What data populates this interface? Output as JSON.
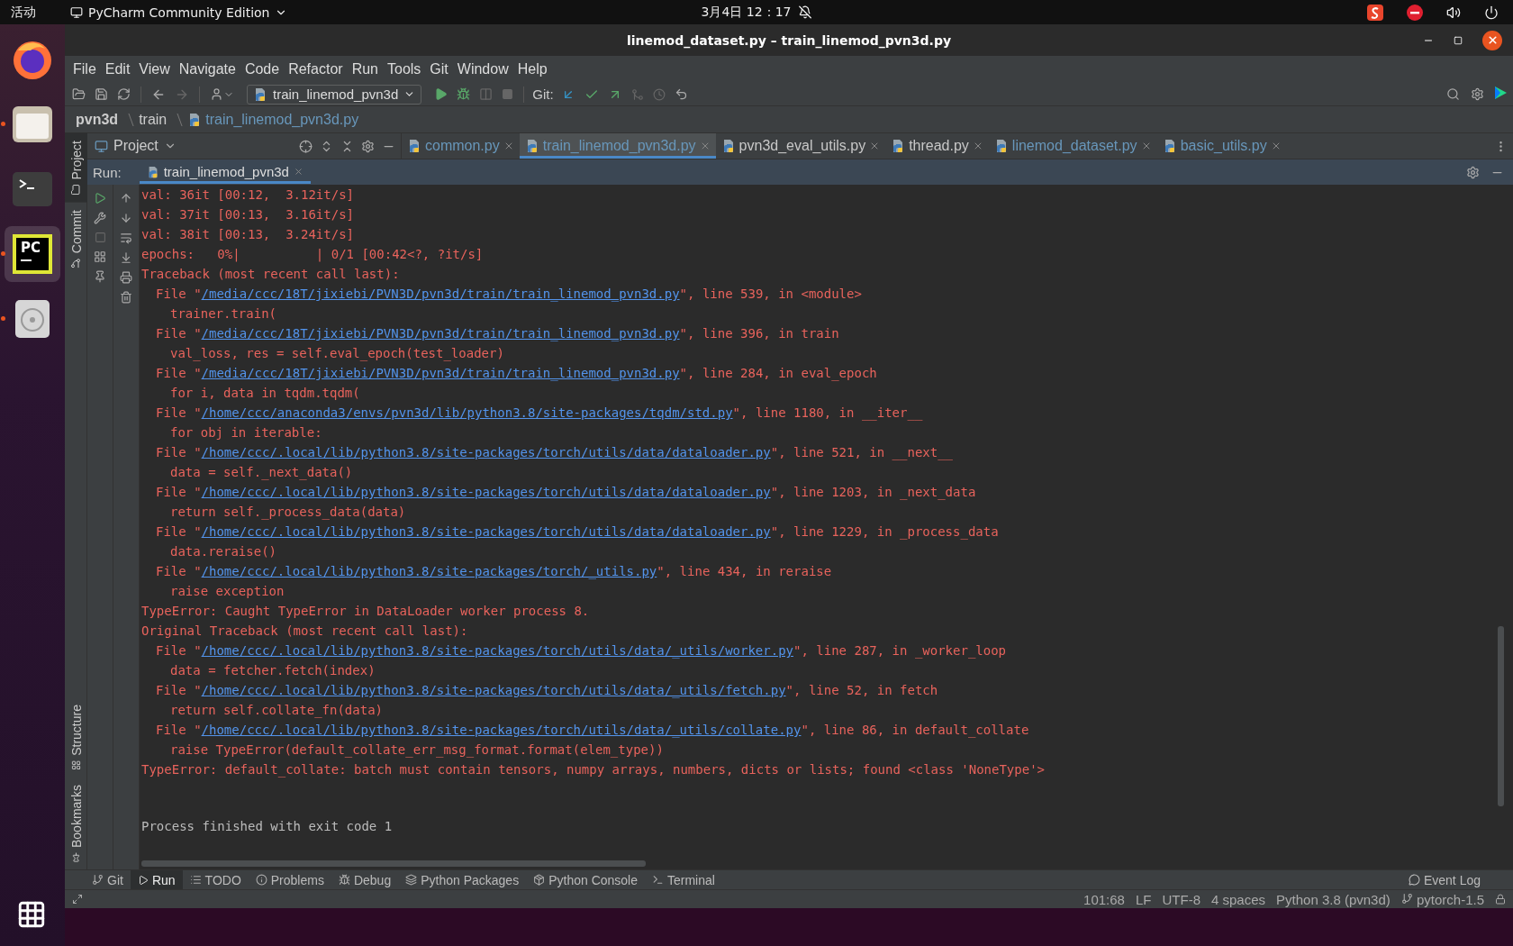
{
  "top_bar": {
    "activities": "活动",
    "app_menu": "PyCharm Community Edition",
    "clock": "3月4日  12：17"
  },
  "dock": {
    "apps": [
      {
        "kind": "firefox",
        "running": false,
        "selected": false
      },
      {
        "kind": "files",
        "running": true,
        "selected": false
      },
      {
        "kind": "terminal",
        "running": false,
        "selected": false
      },
      {
        "kind": "pycharm",
        "label": "PC",
        "running": true,
        "selected": true
      },
      {
        "kind": "disc",
        "running": true,
        "selected": false
      }
    ]
  },
  "window": {
    "title": "linemod_dataset.py – train_linemod_pvn3d.py"
  },
  "menu": [
    "File",
    "Edit",
    "View",
    "Navigate",
    "Code",
    "Refactor",
    "Run",
    "Tools",
    "Git",
    "Window",
    "Help"
  ],
  "toolbar": {
    "run_config": "train_linemod_pvn3d",
    "git_label": "Git:"
  },
  "breadcrumb": [
    {
      "label": "pvn3d",
      "kind": "folder"
    },
    {
      "label": "train",
      "kind": "folder"
    },
    {
      "label": "train_linemod_pvn3d.py",
      "kind": "file"
    }
  ],
  "project_panel": {
    "title": "Project"
  },
  "editor_tabs": [
    {
      "label": "common.py",
      "selected": false,
      "modified": true
    },
    {
      "label": "train_linemod_pvn3d.py",
      "selected": true,
      "modified": true
    },
    {
      "label": "pvn3d_eval_utils.py",
      "selected": false,
      "modified": false
    },
    {
      "label": "thread.py",
      "selected": false,
      "modified": false
    },
    {
      "label": "linemod_dataset.py",
      "selected": false,
      "modified": true
    },
    {
      "label": "basic_utils.py",
      "selected": false,
      "modified": true
    }
  ],
  "side_stripe": {
    "top": [
      {
        "label": "Project",
        "selected": true
      },
      {
        "label": "Commit",
        "selected": false
      }
    ],
    "bottom": [
      {
        "label": "Structure",
        "selected": false
      },
      {
        "label": "Bookmarks",
        "selected": false
      }
    ]
  },
  "run_panel": {
    "label": "Run:",
    "tab": "train_linemod_pvn3d",
    "lines": [
      {
        "kind": "plain",
        "text": "val: 36it [00:12,  3.12it/s]"
      },
      {
        "kind": "plain",
        "text": "val: 37it [00:13,  3.16it/s]"
      },
      {
        "kind": "plain",
        "text": "val: 38it [00:13,  3.24it/s]"
      },
      {
        "kind": "plain",
        "text": "epochs:   0%|          | 0/1 [00:42<?, ?it/s]"
      },
      {
        "kind": "plain",
        "text": "Traceback (most recent call last):"
      },
      {
        "kind": "file",
        "prefix": "File \"",
        "path": "/media/ccc/18T/jixiebi/PVN3D/pvn3d/train/train_linemod_pvn3d.py",
        "rest": "\", line 539, in <module>"
      },
      {
        "kind": "code",
        "text": "trainer.train("
      },
      {
        "kind": "file",
        "prefix": "File \"",
        "path": "/media/ccc/18T/jixiebi/PVN3D/pvn3d/train/train_linemod_pvn3d.py",
        "rest": "\", line 396, in train"
      },
      {
        "kind": "code",
        "text": "val_loss, res = self.eval_epoch(test_loader)"
      },
      {
        "kind": "file",
        "prefix": "File \"",
        "path": "/media/ccc/18T/jixiebi/PVN3D/pvn3d/train/train_linemod_pvn3d.py",
        "rest": "\", line 284, in eval_epoch"
      },
      {
        "kind": "code",
        "text": "for i, data in tqdm.tqdm("
      },
      {
        "kind": "file",
        "prefix": "File \"",
        "path": "/home/ccc/anaconda3/envs/pvn3d/lib/python3.8/site-packages/tqdm/std.py",
        "rest": "\", line 1180, in __iter__"
      },
      {
        "kind": "code",
        "text": "for obj in iterable:"
      },
      {
        "kind": "file",
        "prefix": "File \"",
        "path": "/home/ccc/.local/lib/python3.8/site-packages/torch/utils/data/dataloader.py",
        "rest": "\", line 521, in __next__"
      },
      {
        "kind": "code",
        "text": "data = self._next_data()"
      },
      {
        "kind": "file",
        "prefix": "File \"",
        "path": "/home/ccc/.local/lib/python3.8/site-packages/torch/utils/data/dataloader.py",
        "rest": "\", line 1203, in _next_data"
      },
      {
        "kind": "code",
        "text": "return self._process_data(data)"
      },
      {
        "kind": "file",
        "prefix": "File \"",
        "path": "/home/ccc/.local/lib/python3.8/site-packages/torch/utils/data/dataloader.py",
        "rest": "\", line 1229, in _process_data"
      },
      {
        "kind": "code",
        "text": "data.reraise()"
      },
      {
        "kind": "file",
        "prefix": "File \"",
        "path": "/home/ccc/.local/lib/python3.8/site-packages/torch/_utils.py",
        "rest": "\", line 434, in reraise"
      },
      {
        "kind": "code",
        "text": "raise exception"
      },
      {
        "kind": "plain",
        "text": "TypeError: Caught TypeError in DataLoader worker process 8."
      },
      {
        "kind": "plain",
        "text": "Original Traceback (most recent call last):"
      },
      {
        "kind": "file",
        "prefix": "File \"",
        "path": "/home/ccc/.local/lib/python3.8/site-packages/torch/utils/data/_utils/worker.py",
        "rest": "\", line 287, in _worker_loop"
      },
      {
        "kind": "code",
        "text": "data = fetcher.fetch(index)"
      },
      {
        "kind": "file",
        "prefix": "File \"",
        "path": "/home/ccc/.local/lib/python3.8/site-packages/torch/utils/data/_utils/fetch.py",
        "rest": "\", line 52, in fetch"
      },
      {
        "kind": "code",
        "text": "return self.collate_fn(data)"
      },
      {
        "kind": "file",
        "prefix": "File \"",
        "path": "/home/ccc/.local/lib/python3.8/site-packages/torch/utils/data/_utils/collate.py",
        "rest": "\", line 86, in default_collate"
      },
      {
        "kind": "code",
        "text": "raise TypeError(default_collate_err_msg_format.format(elem_type))"
      },
      {
        "kind": "plain",
        "text": "TypeError: default_collate: batch must contain tensors, numpy arrays, numbers, dicts or lists; found <class 'NoneType'>"
      },
      {
        "kind": "exit",
        "text": "Process finished with exit code 1"
      }
    ]
  },
  "tool_tabs": [
    {
      "label": "Git",
      "kind": "git",
      "selected": false
    },
    {
      "label": "Run",
      "kind": "run",
      "selected": true
    },
    {
      "label": "TODO",
      "kind": "todo",
      "selected": false
    },
    {
      "label": "Problems",
      "kind": "problems",
      "selected": false
    },
    {
      "label": "Debug",
      "kind": "debug",
      "selected": false
    },
    {
      "label": "Python Packages",
      "kind": "packages",
      "selected": false
    },
    {
      "label": "Python Console",
      "kind": "console",
      "selected": false
    },
    {
      "label": "Terminal",
      "kind": "terminal",
      "selected": false
    }
  ],
  "event_log": "Event Log",
  "status_bar": {
    "items": [
      "101:68",
      "LF",
      "UTF-8",
      "4 spaces",
      "Python 3.8 (pvn3d)"
    ],
    "branch": "pytorch-1.5"
  }
}
